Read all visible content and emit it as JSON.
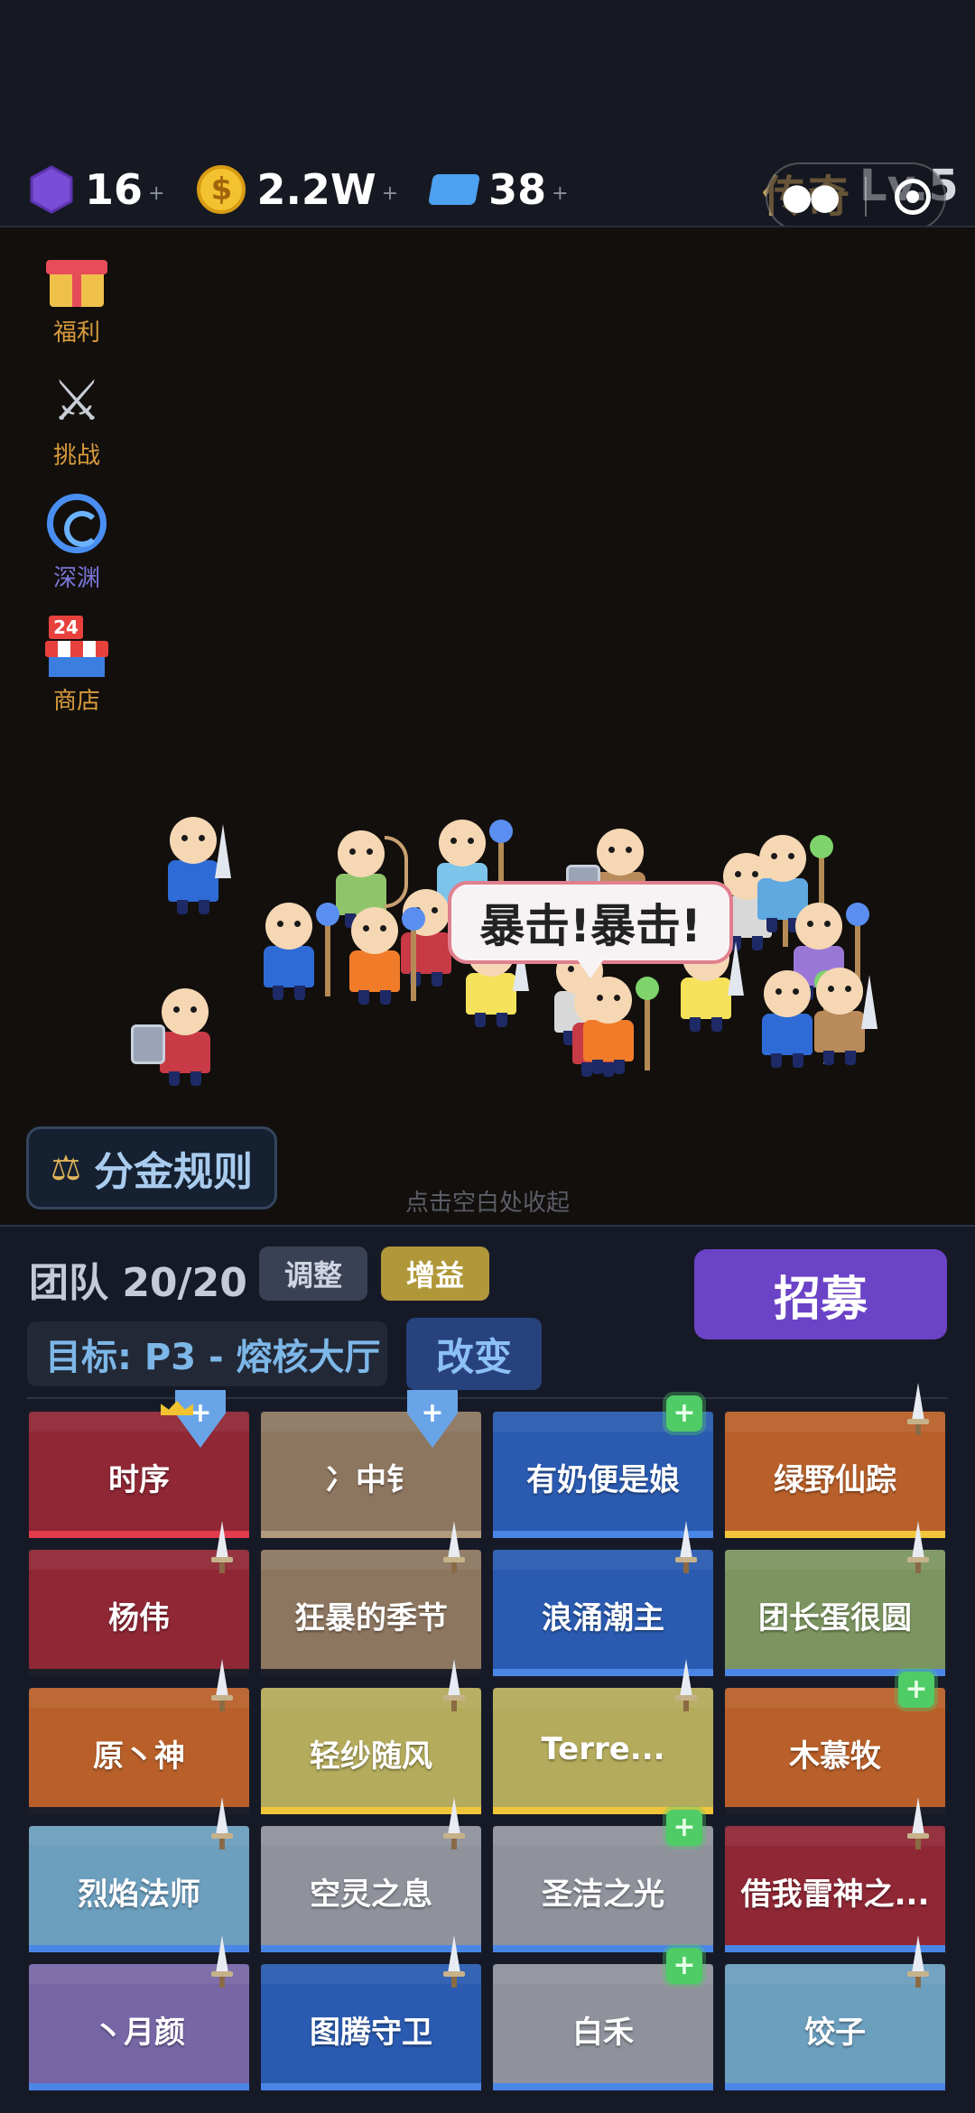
{
  "currencies": [
    {
      "icon": "gem-icon",
      "value": "16",
      "plus": "+"
    },
    {
      "icon": "coin-icon",
      "value": "2.2W",
      "plus": "+"
    },
    {
      "icon": "ticket-icon",
      "value": "38",
      "plus": "+"
    }
  ],
  "coin_symbol": "$",
  "rank": {
    "title": "传奇",
    "level": "Lv.5"
  },
  "side_menu": [
    {
      "id": "welfare",
      "label": "福利",
      "icon": "gift-icon"
    },
    {
      "id": "challenge",
      "label": "挑战",
      "icon": "crossed-swords-icon"
    },
    {
      "id": "abyss",
      "label": "深渊",
      "icon": "swirl-icon"
    },
    {
      "id": "shop",
      "label": "商店",
      "icon": "shop-icon",
      "badge": "24"
    }
  ],
  "battle": {
    "bubble_text": "暴击!暴击!",
    "rules_button": "分金规则",
    "hint": "点击空白处收起"
  },
  "team": {
    "label": "团队 20/20",
    "adjust_button": "调整",
    "buff_button": "增益",
    "recruit_button": "招募",
    "target_label": "目标: P3 - 熔核大厅",
    "change_button": "改变"
  },
  "cards": [
    {
      "name": "时序",
      "color": "#8f2735",
      "stripe": "#e23b4e",
      "role": "tank",
      "leader": true
    },
    {
      "name": "冫中钅",
      "color": "#8d7660",
      "stripe": "#b29a7d",
      "role": "tank"
    },
    {
      "name": "有奶便是娘",
      "color": "#2a5bb0",
      "stripe": "#4a86e6",
      "role": "heal"
    },
    {
      "name": "绿野仙踪",
      "color": "#b9602a",
      "stripe": "#f0c53a",
      "role": "sword"
    },
    {
      "name": "杨伟",
      "color": "#8f2735",
      "stripe": "#1d1f28",
      "role": "sword"
    },
    {
      "name": "狂暴的季节",
      "color": "#8d7660",
      "stripe": "#1d1f28",
      "role": "sword"
    },
    {
      "name": "浪涌潮主",
      "color": "#2a5bb0",
      "stripe": "#4a86e6",
      "role": "sword"
    },
    {
      "name": "团长蛋很圆",
      "color": "#7c9560",
      "stripe": "#4a86e6",
      "role": "sword"
    },
    {
      "name": "原丶神",
      "color": "#b9602a",
      "stripe": "#1d1f28",
      "role": "sword"
    },
    {
      "name": "轻纱随风",
      "color": "#b4ab5c",
      "stripe": "#f0c53a",
      "role": "sword"
    },
    {
      "name": "Terre...",
      "color": "#b4ab5c",
      "stripe": "#f0c53a",
      "role": "sword"
    },
    {
      "name": "木慕牧",
      "color": "#b9602a",
      "stripe": "#1d1f28",
      "role": "heal"
    },
    {
      "name": "烈焰法师",
      "color": "#6c9ebe",
      "stripe": "#4a86e6",
      "role": "sword"
    },
    {
      "name": "空灵之息",
      "color": "#8f929b",
      "stripe": "#4a86e6",
      "role": "sword"
    },
    {
      "name": "圣洁之光",
      "color": "#8f929b",
      "stripe": "#4a86e6",
      "role": "heal"
    },
    {
      "name": "借我雷神之...",
      "color": "#8f2735",
      "stripe": "#4a86e6",
      "role": "sword"
    },
    {
      "name": "丶月颜",
      "color": "#7766a6",
      "stripe": "#4a86e6",
      "role": "sword"
    },
    {
      "name": "图腾守卫",
      "color": "#2a5bb0",
      "stripe": "#4a86e6",
      "role": "sword"
    },
    {
      "name": "白禾",
      "color": "#8f929b",
      "stripe": "#4a86e6",
      "role": "heal"
    },
    {
      "name": "饺子",
      "color": "#6c9ebe",
      "stripe": "#4a86e6",
      "role": "sword"
    }
  ]
}
